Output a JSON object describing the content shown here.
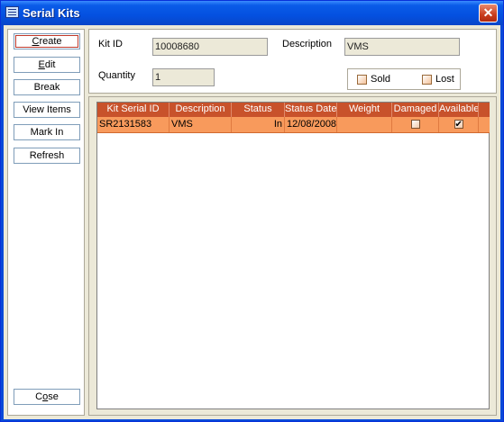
{
  "window": {
    "title": "Serial Kits",
    "close_glyph": "✕"
  },
  "sidebar": {
    "buttons": [
      {
        "label": "Create",
        "mnemonic": "C"
      },
      {
        "label": "Edit",
        "mnemonic": "E"
      },
      {
        "label": "Break"
      },
      {
        "label": "View Items"
      },
      {
        "label": "Mark In"
      },
      {
        "label": "Refresh"
      }
    ],
    "close": {
      "label": "Close",
      "mnemonic": "o"
    }
  },
  "form": {
    "kit_id_label": "Kit ID",
    "kit_id_value": "10008680",
    "description_label": "Description",
    "description_value": "VMS",
    "quantity_label": "Quantity",
    "quantity_value": "1",
    "sold_label": "Sold",
    "lost_label": "Lost"
  },
  "grid": {
    "columns": [
      "Kit Serial ID",
      "Description",
      "Status",
      "Status Date",
      "Weight",
      "Damaged",
      "Available"
    ],
    "rows": [
      {
        "kit_serial_id": "SR2131583",
        "description": "VMS",
        "status": "In",
        "status_date": "12/08/2008",
        "weight": "",
        "damaged": false,
        "available": true
      }
    ]
  },
  "colors": {
    "header_bg": "#c8522b",
    "selected_row_bg": "#f89a5c",
    "title_bar": "#0a5ce8"
  }
}
